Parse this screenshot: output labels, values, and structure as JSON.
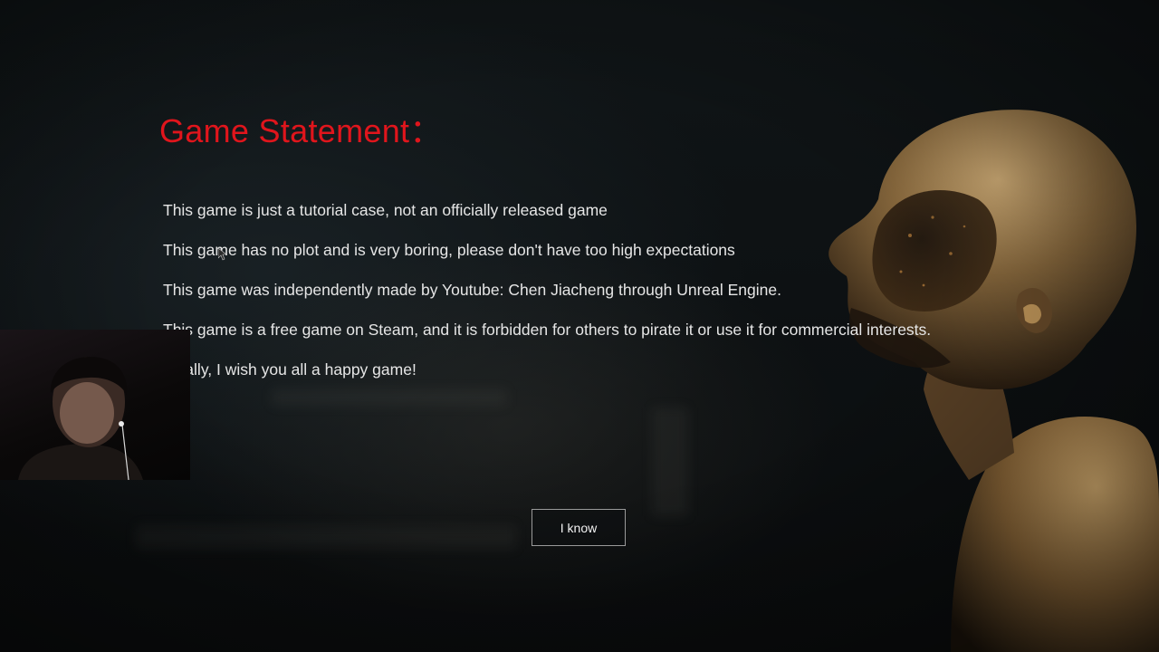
{
  "statement": {
    "title": "Game Statement：",
    "lines": [
      "This game is just a tutorial case, not an officially released game",
      "This game has no plot and is very boring, please don't have too high expectations",
      "This game was independently made by Youtube: Chen Jiacheng through Unreal Engine.",
      "This game is a free game on Steam, and it is forbidden for others to pirate it or use it for commercial interests.",
      "Finally, I wish you all a happy game!"
    ]
  },
  "button": {
    "label": "I know"
  },
  "colors": {
    "title": "#e0151c",
    "text": "#e6e6e6",
    "background": "#0c0f11",
    "button_border": "#9a9a9a"
  },
  "icons": {
    "cursor": "mouse-pointer-icon"
  }
}
